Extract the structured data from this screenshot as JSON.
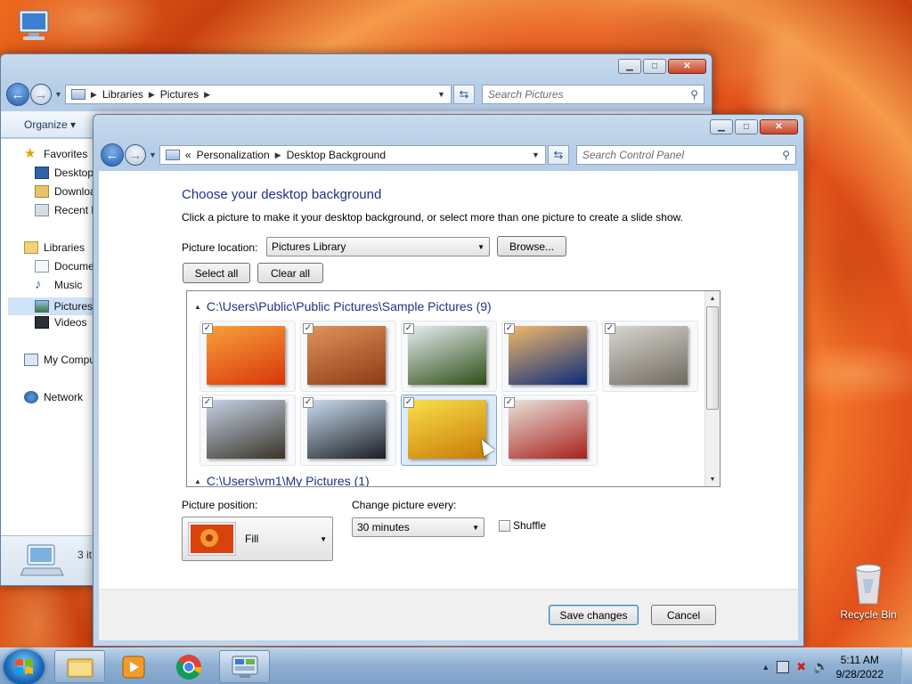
{
  "desktop": {
    "icons": [
      {
        "name": "computer",
        "label": ""
      },
      {
        "name": "recycle-bin",
        "label": "Recycle Bin"
      }
    ]
  },
  "explorer": {
    "path": [
      "Libraries",
      "Pictures"
    ],
    "search_placeholder": "Search Pictures",
    "toolbar": {
      "organize": "Organize"
    },
    "nav": {
      "favorites": "Favorites",
      "desktop": "Desktop",
      "downloads": "Downloa",
      "recent": "Recent P",
      "libraries": "Libraries",
      "documents": "Docume",
      "music": "Music",
      "pictures": "Pictures",
      "videos": "Videos",
      "computer": "My Compu",
      "network": "Network"
    },
    "details": "3 it"
  },
  "control_panel": {
    "path_prefix": "«",
    "path": [
      "Personalization",
      "Desktop Background"
    ],
    "search_placeholder": "Search Control Panel",
    "heading": "Choose your desktop background",
    "description": "Click a picture to make it your desktop background, or select more than one picture to create a slide show.",
    "picture_location_label": "Picture location:",
    "picture_location_value": "Pictures Library",
    "browse_button": "Browse...",
    "select_all": "Select all",
    "clear_all": "Clear all",
    "groups": [
      {
        "title": "C:\\Users\\Public\\Public Pictures\\Sample Pictures (9)"
      },
      {
        "title": "C:\\Users\\vm1\\My Pictures (1)"
      }
    ],
    "thumbnails": [
      {
        "name": "chrysanthemum",
        "checked": "✓",
        "colors": [
          "#f6a13a",
          "#d8360b"
        ]
      },
      {
        "name": "desert",
        "checked": "✓",
        "colors": [
          "#e0935c",
          "#8c3b14"
        ]
      },
      {
        "name": "hydrangeas",
        "checked": "✓",
        "colors": [
          "#e7ecf1",
          "#2d4f16"
        ]
      },
      {
        "name": "jellyfish",
        "checked": "✓",
        "colors": [
          "#f3b86a",
          "#0b2c7a"
        ]
      },
      {
        "name": "koala",
        "checked": "✓",
        "colors": [
          "#d9d6cf",
          "#6f6a60"
        ]
      },
      {
        "name": "lighthouse",
        "checked": "✓",
        "colors": [
          "#c4d2e6",
          "#3a3326"
        ]
      },
      {
        "name": "penguins",
        "checked": "✓",
        "colors": [
          "#c9dcef",
          "#1a1d22"
        ]
      },
      {
        "name": "tulips",
        "checked": "✓",
        "colors": [
          "#f8e04a",
          "#c87b06"
        ]
      },
      {
        "name": "santa",
        "checked": "✓",
        "colors": [
          "#e8e2db",
          "#a8201b"
        ]
      }
    ],
    "picture_position_label": "Picture position:",
    "picture_position_value": "Fill",
    "change_every_label": "Change picture every:",
    "change_every_value": "30 minutes",
    "shuffle_label": "Shuffle",
    "save_changes": "Save changes",
    "cancel": "Cancel"
  },
  "taskbar": {
    "apps": [
      "windows-explorer",
      "media-player",
      "chrome",
      "control-panel"
    ],
    "time": "5:11 AM",
    "date": "9/28/2022"
  }
}
